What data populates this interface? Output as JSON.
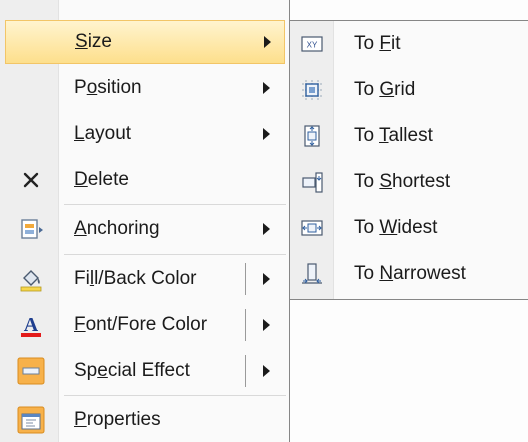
{
  "menu": {
    "items": [
      {
        "pre": "",
        "key": "S",
        "post": "ize",
        "has_submenu": true,
        "split": false,
        "icon": "none"
      },
      {
        "pre": "P",
        "key": "o",
        "post": "sition",
        "has_submenu": true,
        "split": false,
        "icon": "none"
      },
      {
        "pre": "",
        "key": "L",
        "post": "ayout",
        "has_submenu": true,
        "split": false,
        "icon": "none"
      },
      {
        "pre": "",
        "key": "D",
        "post": "elete",
        "has_submenu": false,
        "split": false,
        "icon": "delete-x-icon"
      },
      {
        "pre": "",
        "key": "A",
        "post": "nchoring",
        "has_submenu": true,
        "split": false,
        "icon": "anchoring-icon"
      },
      {
        "pre": "Fi",
        "key": "l",
        "post": "l/Back Color",
        "has_submenu": true,
        "split": true,
        "icon": "fill-color-icon"
      },
      {
        "pre": "",
        "key": "F",
        "post": "ont/Fore Color",
        "has_submenu": true,
        "split": true,
        "icon": "font-color-icon"
      },
      {
        "pre": "Sp",
        "key": "e",
        "post": "cial Effect",
        "has_submenu": true,
        "split": true,
        "icon": "special-effect-icon"
      },
      {
        "pre": "",
        "key": "P",
        "post": "roperties",
        "has_submenu": false,
        "split": false,
        "icon": "properties-icon"
      }
    ]
  },
  "submenu": {
    "items": [
      {
        "pre": "To ",
        "key": "F",
        "post": "it",
        "icon": "size-to-fit-icon"
      },
      {
        "pre": "To ",
        "key": "G",
        "post": "rid",
        "icon": "size-to-grid-icon"
      },
      {
        "pre": "To ",
        "key": "T",
        "post": "allest",
        "icon": "size-to-tallest-icon"
      },
      {
        "pre": "To ",
        "key": "S",
        "post": "hortest",
        "icon": "size-to-shortest-icon"
      },
      {
        "pre": "To ",
        "key": "W",
        "post": "idest",
        "icon": "size-to-widest-icon"
      },
      {
        "pre": "To ",
        "key": "N",
        "post": "arrowest",
        "icon": "size-to-narrowest-icon"
      }
    ]
  },
  "colors": {
    "highlight_top": "#fff4cf",
    "highlight_bottom": "#fddf8c",
    "font_color_bar": "#e31b1b",
    "accent_orange": "#f7b14a"
  }
}
